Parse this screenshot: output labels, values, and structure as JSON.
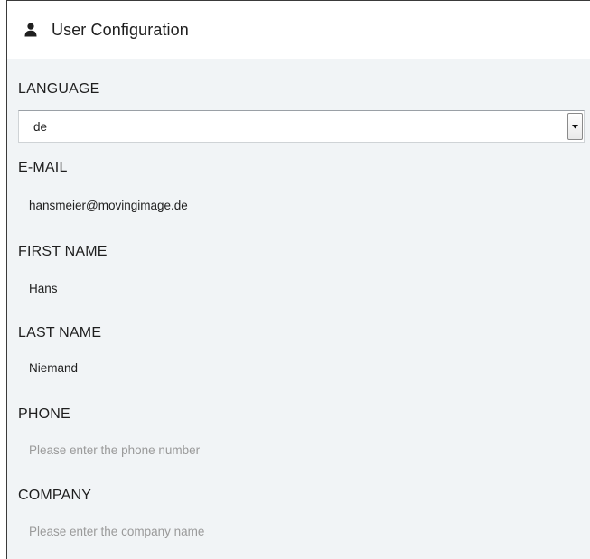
{
  "header": {
    "icon": "user-icon",
    "title": "User Configuration"
  },
  "language": {
    "label": "LANGUAGE",
    "selected": "de"
  },
  "email": {
    "label": "E-MAIL",
    "value": "hansmeier@movingimage.de"
  },
  "first_name": {
    "label": "FIRST NAME",
    "value": "Hans"
  },
  "last_name": {
    "label": "LAST NAME",
    "value": "Niemand"
  },
  "phone": {
    "label": "PHONE",
    "placeholder": "Please enter the phone number"
  },
  "company": {
    "label": "COMPANY",
    "placeholder": "Please enter the company name"
  },
  "colors": {
    "panel_bg": "#f1f4f6",
    "header_bg": "#ffffff",
    "placeholder": "#9a9a9a"
  }
}
